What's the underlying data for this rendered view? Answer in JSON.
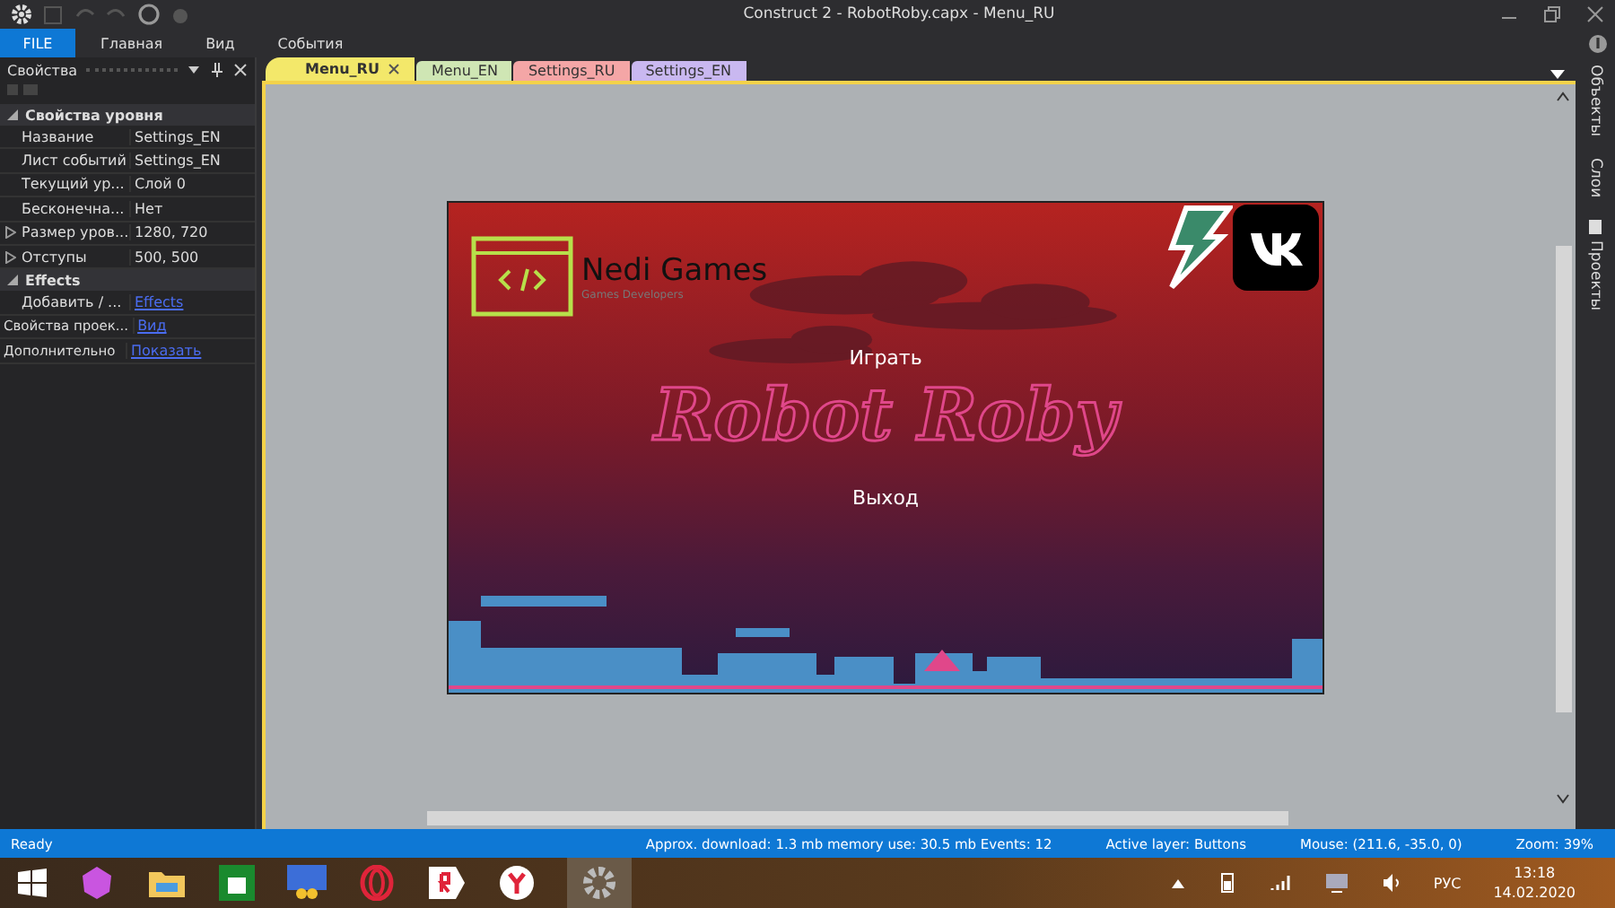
{
  "window": {
    "title": "Construct 2 - RobotRoby.capx - Menu_RU"
  },
  "ribbon": {
    "tabs": [
      {
        "label": "FILE",
        "kind": "file",
        "selected": true
      },
      {
        "label": "Главная",
        "kind": "tab",
        "selected": false
      },
      {
        "label": "Вид",
        "kind": "tab",
        "selected": false
      },
      {
        "label": "События",
        "kind": "tab",
        "selected": false
      }
    ]
  },
  "properties": {
    "title": "Свойства",
    "sections": [
      {
        "title": "Свойства уровня",
        "expanded": true,
        "rows": [
          {
            "name": "Название",
            "value": "Settings_EN",
            "kind": "text",
            "expandable": false
          },
          {
            "name": "Лист событий",
            "value": "Settings_EN",
            "kind": "text",
            "expandable": false
          },
          {
            "name": "Текущий ур...",
            "value": "Слой 0",
            "kind": "text",
            "expandable": false
          },
          {
            "name": "Бесконечна...",
            "value": "Нет",
            "kind": "text",
            "expandable": false
          },
          {
            "name": "Размер уров...",
            "value": "1280, 720",
            "kind": "text",
            "expandable": true
          },
          {
            "name": "Отступы",
            "value": "500, 500",
            "kind": "text",
            "expandable": true
          }
        ]
      },
      {
        "title": "Effects",
        "expanded": true,
        "rows": [
          {
            "name": "Добавить / ...",
            "value": "Effects",
            "kind": "link",
            "expandable": false
          }
        ]
      }
    ],
    "extra_rows": [
      {
        "name": "Свойства проек...",
        "value": "Вид",
        "kind": "link"
      },
      {
        "name": "Дополнительно",
        "value": "Показать",
        "kind": "link"
      }
    ]
  },
  "layout_tabs": [
    {
      "label": "Menu_RU",
      "color": "#f3e86a",
      "selected": true
    },
    {
      "label": "Menu_EN",
      "color": "#cfe6b4",
      "selected": false
    },
    {
      "label": "Settings_RU",
      "color": "#f4a6a6",
      "selected": false
    },
    {
      "label": "Settings_EN",
      "color": "#c9b8f0",
      "selected": false
    }
  ],
  "game": {
    "logo_title": "Nedi Games",
    "logo_subtitle": "Games Developers",
    "title": "Robot Roby",
    "buttons": [
      "Играть",
      "Выход"
    ]
  },
  "right_dock": [
    {
      "label": "Объекты"
    },
    {
      "label": "Слои"
    },
    {
      "label": "Проекты"
    }
  ],
  "status_bar": {
    "state": "Ready",
    "download": "Approx. download: 1.3 mb  memory use: 30.5 mb  Events: 12",
    "layer": "Active layer: Buttons",
    "mouse": "Mouse: (211.6, -35.0, 0)",
    "zoom": "Zoom: 39%"
  },
  "taskbar": {
    "language": "РУС",
    "time": "13:18",
    "date": "14.02.2020"
  }
}
